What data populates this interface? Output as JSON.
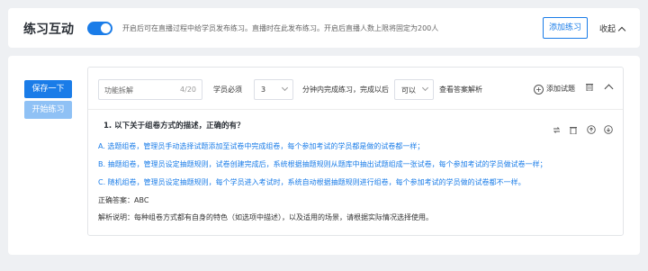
{
  "header": {
    "title": "练习互动",
    "hint": "开启后可在直播过程中给学员发布练习。直播时在此发布练习。开启后直播人数上限将固定为200人",
    "add_practice": "添加练习",
    "collapse": "收起",
    "toggle_on": true
  },
  "left": {
    "save": "保存一下",
    "start": "开始练习"
  },
  "toolbar": {
    "name_value": "功能拆解",
    "name_count": "4/20",
    "must_label": "学员必须",
    "minutes_value": "3",
    "minutes_label": "分钟内完成练习，完成以后",
    "view_value": "可以",
    "view_label": "查看答案解析",
    "add_question": "添加试题"
  },
  "question": {
    "title": "1. 以下关于组卷方式的描述，正确的有？",
    "options": [
      "A. 选题组卷，管理员手动选择试题添加至试卷中完成组卷，每个参加考试的学员都是做的试卷都一样；",
      "B. 抽题组卷，管理员设定抽题规则，试卷创建完成后，系统根据抽题规则从题库中抽出试题组成一张试卷，每个参加考试的学员做试卷一样；",
      "C. 随机组卷，管理员设定抽题规则，每个学员进入考试时，系统自动根据抽题规则进行组卷，每个参加考试的学员做的试卷都不一样。"
    ],
    "answer": "正确答案：ABC",
    "explanation": "解析说明：每种组卷方式都有自身的特色（如选项中描述），以及适用的场景，请根据实际情况选择使用。"
  },
  "colors": {
    "accent": "#1a7ce8",
    "accent_light": "#8fc1f5"
  }
}
